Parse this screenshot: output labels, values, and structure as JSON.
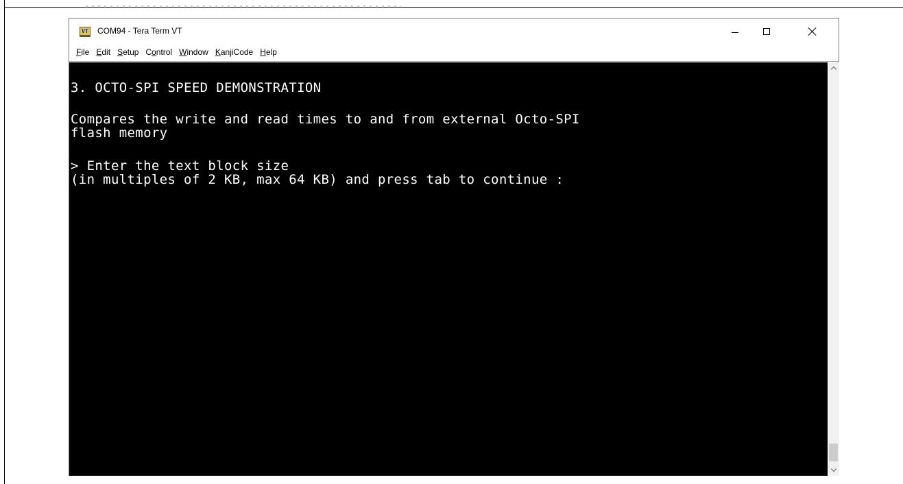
{
  "window": {
    "title": "COM94 - Tera Term VT",
    "icon": "teraterm-vt-icon",
    "icon_label": "VT"
  },
  "menu": [
    {
      "pre": "",
      "key": "F",
      "post": "ile"
    },
    {
      "pre": "",
      "key": "E",
      "post": "dit"
    },
    {
      "pre": "",
      "key": "S",
      "post": "etup"
    },
    {
      "pre": "C",
      "key": "o",
      "post": "ntrol"
    },
    {
      "pre": "",
      "key": "W",
      "post": "indow"
    },
    {
      "pre": "",
      "key": "K",
      "post": "anjiCode"
    },
    {
      "pre": "",
      "key": "H",
      "post": "elp"
    }
  ],
  "terminal": {
    "lines": [
      "3. OCTO-SPI SPEED DEMONSTRATION",
      "Compares the write and read times to and from external Octo-SPI",
      "flash memory",
      "> Enter the text block size",
      "(in multiples of 2 KB, max 64 KB) and press tab to continue :"
    ]
  },
  "colors": {
    "terminal_bg": "#000000",
    "terminal_fg": "#ffffff"
  }
}
